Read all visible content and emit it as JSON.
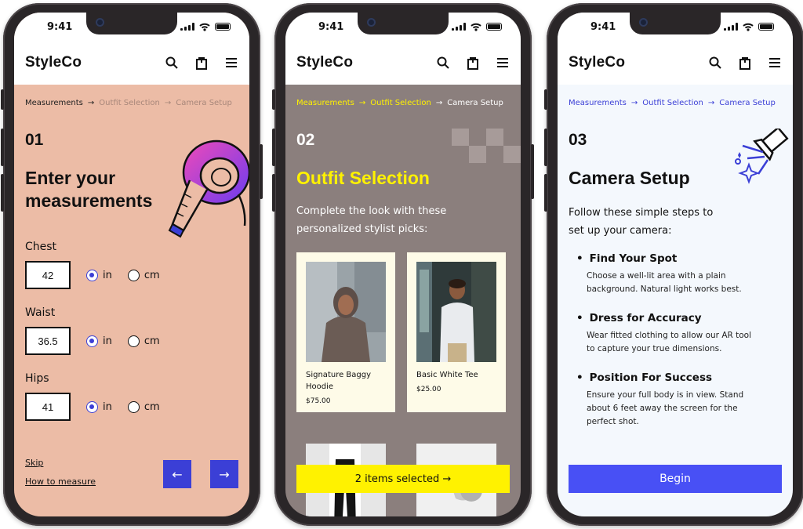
{
  "status": {
    "time": "9:41"
  },
  "brand": "StyleCo",
  "screen1": {
    "crumbs": [
      "Measurements",
      "Outfit Selection",
      "Camera Setup"
    ],
    "step": "01",
    "title_line1": "Enter your",
    "title_line2": "measurements",
    "fields": [
      {
        "label": "Chest",
        "value": "42",
        "unit_selected": "in"
      },
      {
        "label": "Waist",
        "value": "36.5",
        "unit_selected": "in"
      },
      {
        "label": "Hips",
        "value": "41",
        "unit_selected": "in"
      }
    ],
    "units": [
      "in",
      "cm"
    ],
    "skip": "Skip",
    "how_to": "How to measure",
    "prev_arrow": "←",
    "next_arrow": "→"
  },
  "screen2": {
    "crumbs": [
      "Measurements",
      "Outfit Selection",
      "Camera Setup"
    ],
    "step": "02",
    "title": "Outfit Selection",
    "lead_line1": "Complete the look with these",
    "lead_line2": "personalized stylist picks:",
    "products": [
      {
        "name_line1": "Signature Baggy",
        "name_line2": "Hoodie",
        "price": "$75.00"
      },
      {
        "name_line1": "Basic White Tee",
        "name_line2": "",
        "price": "$25.00"
      }
    ],
    "cta": "2 items selected →"
  },
  "screen3": {
    "crumbs": [
      "Measurements",
      "Outfit Selection",
      "Camera Setup"
    ],
    "step": "03",
    "title": "Camera Setup",
    "lead_line1": "Follow these simple steps to",
    "lead_line2": "set up your camera:",
    "steps": [
      {
        "title": "Find Your Spot",
        "desc_line1": "Choose a well-lit area with a plain",
        "desc_line2": "background. Natural light works best.",
        "desc_line3": ""
      },
      {
        "title": "Dress for Accuracy",
        "desc_line1": "Wear fitted clothing to allow our AR tool",
        "desc_line2": "to capture your true dimensions.",
        "desc_line3": ""
      },
      {
        "title": "Position For Success",
        "desc_line1": "Ensure your full body is in view. Stand",
        "desc_line2": "about 6 feet away the screen for the",
        "desc_line3": "perfect shot."
      }
    ],
    "cta": "Begin"
  },
  "colors": {
    "screen1_bg": "#ecbca6",
    "screen2_bg": "#8b7f7d",
    "screen3_bg": "#f4f8fd",
    "accent_blue": "#3b3fd6",
    "accent_yellow": "#fff200"
  },
  "icons": [
    "search-icon",
    "bag-icon",
    "menu-icon",
    "measuring-tape-illustration",
    "checker-pattern-decoration",
    "flashlight-illustration",
    "arrow-left-icon",
    "arrow-right-icon"
  ]
}
